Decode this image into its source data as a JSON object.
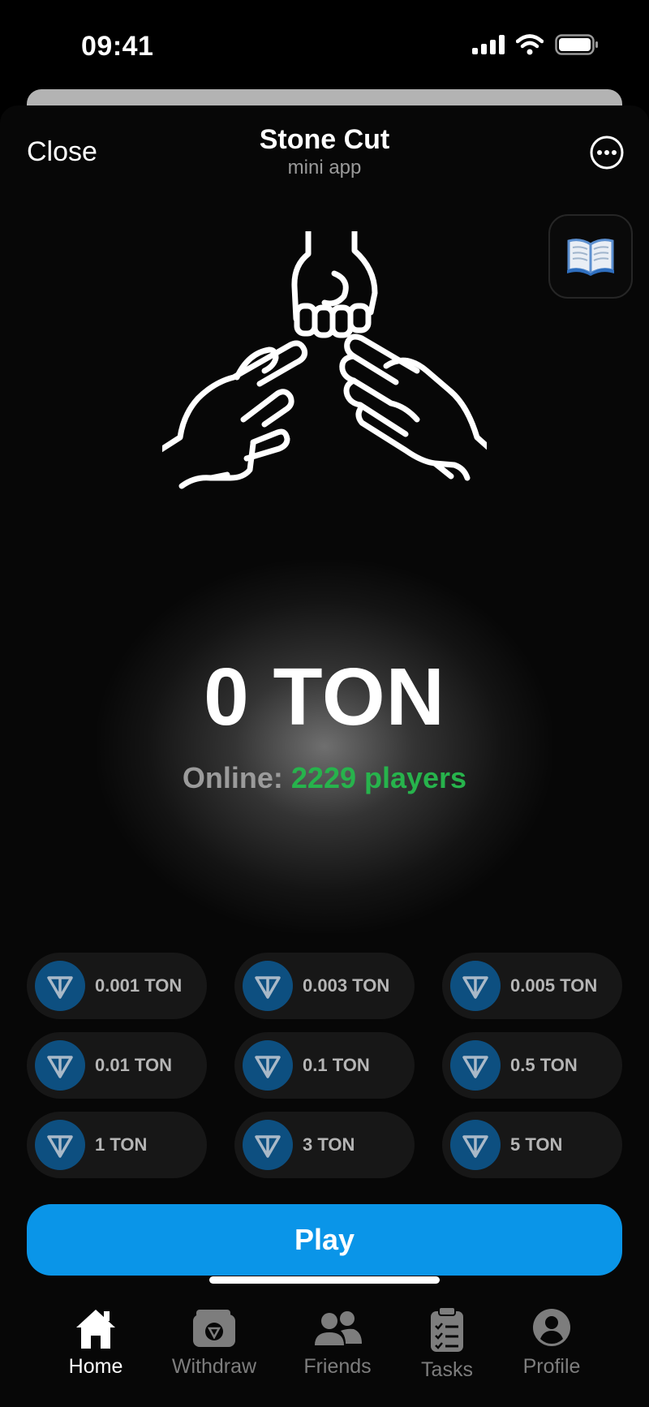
{
  "status_bar": {
    "time": "09:41"
  },
  "header": {
    "close_label": "Close",
    "title": "Stone Cut",
    "subtitle": "mini app"
  },
  "balance": {
    "amount": "0 TON"
  },
  "online": {
    "label": "Online:",
    "count": "2229 players"
  },
  "bets": [
    {
      "label": "0.001 TON"
    },
    {
      "label": "0.003 TON"
    },
    {
      "label": "0.005 TON"
    },
    {
      "label": "0.01 TON"
    },
    {
      "label": "0.1 TON"
    },
    {
      "label": "0.5 TON"
    },
    {
      "label": "1 TON"
    },
    {
      "label": "3 TON"
    },
    {
      "label": "5 TON"
    }
  ],
  "play_label": "Play",
  "tabs": [
    {
      "label": "Home",
      "icon": "home-icon",
      "active": true
    },
    {
      "label": "Withdraw",
      "icon": "wallet-icon",
      "active": false
    },
    {
      "label": "Friends",
      "icon": "friends-icon",
      "active": false
    },
    {
      "label": "Tasks",
      "icon": "tasks-icon",
      "active": false
    },
    {
      "label": "Profile",
      "icon": "profile-icon",
      "active": false
    }
  ],
  "colors": {
    "accent": "#0a95e8",
    "online_green": "#27b34c",
    "ton_badge": "#0d4f80",
    "background": "#070707"
  }
}
